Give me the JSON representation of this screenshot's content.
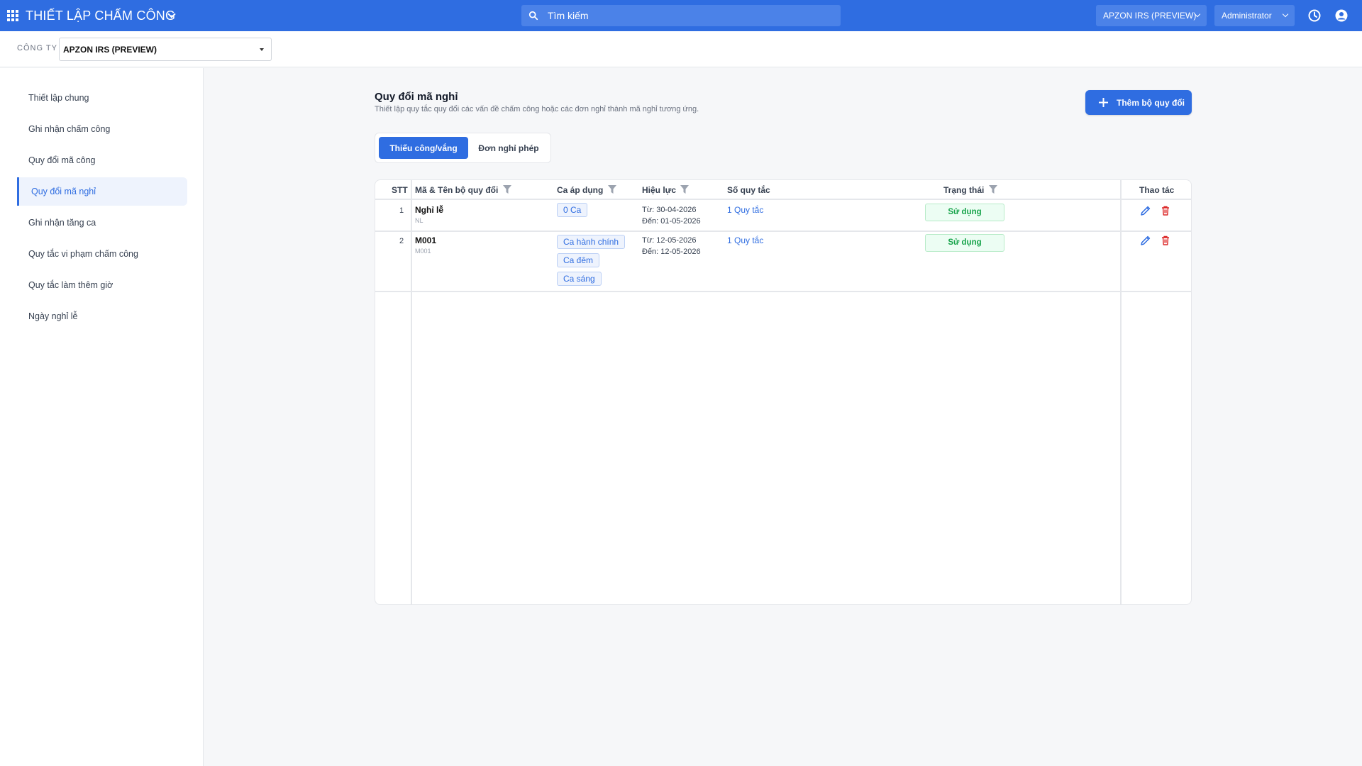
{
  "topbar": {
    "app_title": "THIẾT LẬP CHẤM CÔNG",
    "search_placeholder": "Tìm kiếm",
    "company_switch": "APZON IRS (PREVIEW)",
    "user": "Administrator",
    "accent": "#2f6de1"
  },
  "companybar": {
    "label": "CÔNG TY",
    "value": "APZON IRS (PREVIEW)"
  },
  "sidebar": {
    "items": [
      {
        "label": "Thiết lập chung",
        "active": false
      },
      {
        "label": "Ghi nhận chấm công",
        "active": false
      },
      {
        "label": "Quy đổi mã công",
        "active": false
      },
      {
        "label": "Quy đổi mã nghỉ",
        "active": true
      },
      {
        "label": "Ghi nhận tăng ca",
        "active": false
      },
      {
        "label": "Quy tắc vi phạm chấm công",
        "active": false
      },
      {
        "label": "Quy tắc làm thêm giờ",
        "active": false
      },
      {
        "label": "Ngày nghỉ lễ",
        "active": false
      }
    ]
  },
  "main": {
    "title": "Quy đổi mã nghỉ",
    "subtitle": "Thiết lập quy tắc quy đổi các vấn đề chấm công hoặc các đơn nghỉ thành mã nghỉ tương ứng.",
    "add_button": "Thêm bộ quy đổi",
    "tabs": [
      {
        "label": "Thiếu công/vắng",
        "active": true
      },
      {
        "label": "Đơn nghỉ phép",
        "active": false
      }
    ],
    "table": {
      "headers": {
        "stt": "STT",
        "code_name": "Mã & Tên bộ quy đổi",
        "shifts": "Ca áp dụng",
        "effective": "Hiệu lực",
        "rules": "Số quy tắc",
        "status": "Trạng thái",
        "actions": "Thao tác"
      },
      "rows": [
        {
          "stt": "1",
          "name": "Nghỉ lễ",
          "code": "NL",
          "shifts": [
            "0 Ca"
          ],
          "from": "Từ: 30-04-2026",
          "to": "Đến: 01-05-2026",
          "rules": "1 Quy tắc",
          "status": "Sử dụng"
        },
        {
          "stt": "2",
          "name": "M001",
          "code": "M001",
          "shifts": [
            "Ca hành chính",
            "Ca đêm",
            "Ca sáng"
          ],
          "from": "Từ: 12-05-2026",
          "to": "Đến: 12-05-2026",
          "rules": "1 Quy tắc",
          "status": "Sử dụng"
        }
      ]
    }
  }
}
